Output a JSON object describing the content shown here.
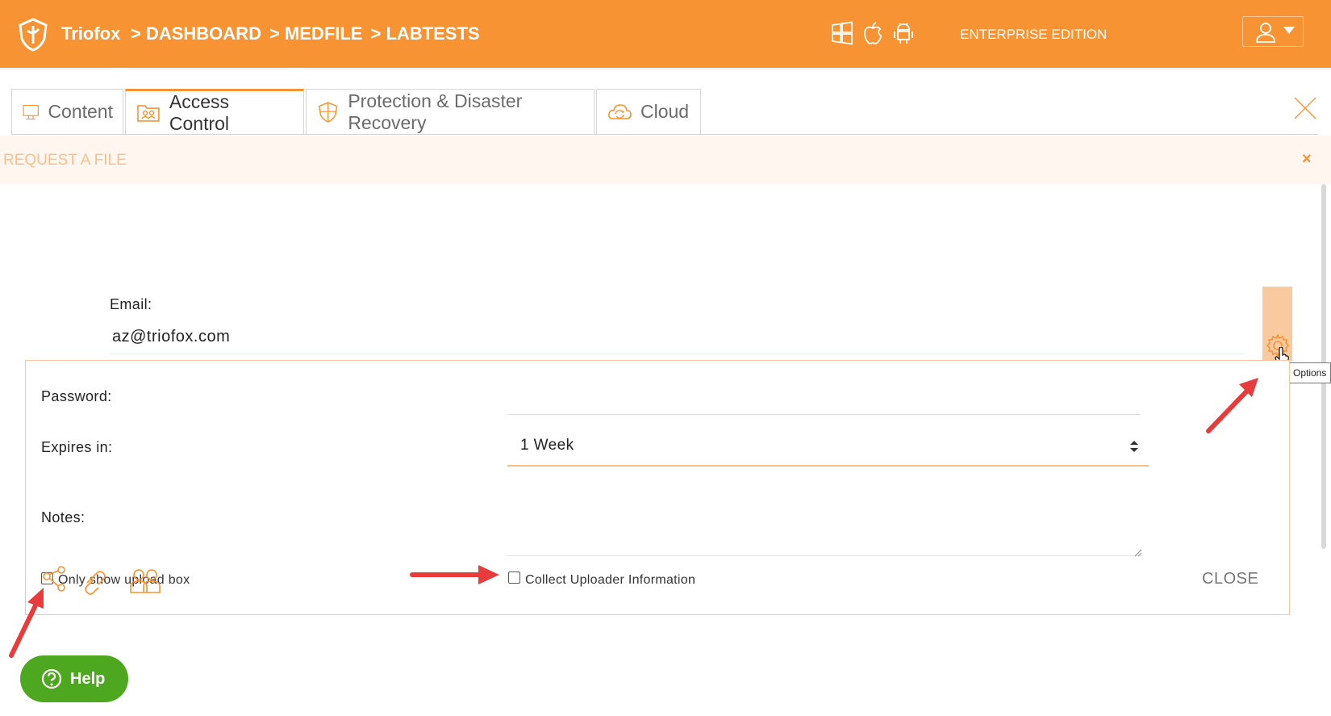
{
  "header": {
    "brand": "Triofox",
    "breadcrumb": [
      ">  DASHBOARD",
      "> MEDFILE",
      ">  LABTESTS"
    ],
    "edition": "ENTERPRISE EDITION",
    "icons": [
      "windows-icon",
      "apple-icon",
      "android-icon",
      "user-icon"
    ]
  },
  "tabs": [
    {
      "label": "Content",
      "icon": "monitor-icon"
    },
    {
      "label": "Access Control",
      "icon": "folder-users-icon",
      "active": true
    },
    {
      "label": "Protection & Disaster Recovery",
      "icon": "shield-icon"
    },
    {
      "label": "Cloud",
      "icon": "cloud-icon"
    }
  ],
  "request": {
    "title": "REQUEST A FILE",
    "close": "×"
  },
  "form": {
    "email_label": "Email:",
    "email_value": "az@triofox.com",
    "options_tooltip": "Options",
    "password_label": "Password:",
    "expires_label": "Expires in:",
    "expires_value": "1 Week",
    "notes_label": "Notes:",
    "only_upload_label": "Only show upload box",
    "collect_label": "Collect Uploader Information",
    "close_button": "CLOSE"
  },
  "help": {
    "label": "Help"
  },
  "colors": {
    "brand": "#f79332",
    "help": "#4da81f",
    "annotation_arrow": "#e83b3b"
  }
}
